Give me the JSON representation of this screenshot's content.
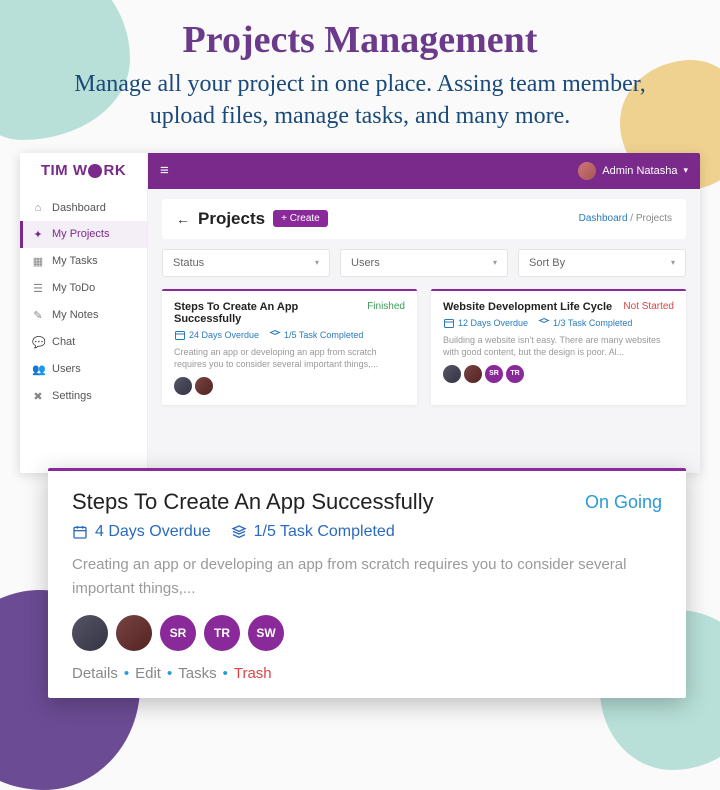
{
  "hero": {
    "title": "Projects Management",
    "subtitle": "Manage all your project in one place. Assing team member, upload files, manage tasks, and many more."
  },
  "logo": {
    "pre": "TIM W",
    "post": "RK"
  },
  "navbar": {
    "user_label": "Admin Natasha"
  },
  "sidebar": {
    "items": [
      {
        "icon": "home-icon",
        "glyph": "⌂",
        "label": "Dashboard"
      },
      {
        "icon": "projects-icon",
        "glyph": "✦",
        "label": "My Projects",
        "active": true
      },
      {
        "icon": "tasks-icon",
        "glyph": "▦",
        "label": "My Tasks"
      },
      {
        "icon": "todo-icon",
        "glyph": "☰",
        "label": "My ToDo"
      },
      {
        "icon": "notes-icon",
        "glyph": "✎",
        "label": "My Notes"
      },
      {
        "icon": "chat-icon",
        "glyph": "💬",
        "label": "Chat"
      },
      {
        "icon": "users-icon",
        "glyph": "👥",
        "label": "Users"
      },
      {
        "icon": "settings-icon",
        "glyph": "✖",
        "label": "Settings"
      }
    ]
  },
  "page": {
    "title": "Projects",
    "create_label": "+ Create",
    "crumb_root": "Dashboard",
    "crumb_sep": " / ",
    "crumb_current": "Projects"
  },
  "filters": {
    "status": "Status",
    "users": "Users",
    "sort": "Sort By"
  },
  "cards": [
    {
      "title": "Steps To Create An App Successfully",
      "status": "Finished",
      "status_class": "st-fin",
      "overdue": "24 Days Overdue",
      "completed": "1/5 Task Completed",
      "desc": "Creating an app or developing an app from scratch requires you to consider several important things,...",
      "avatars": [
        {
          "cls": "img1"
        },
        {
          "cls": "img2"
        }
      ]
    },
    {
      "title": "Website Development Life Cycle",
      "status": "Not Started",
      "status_class": "st-not",
      "overdue": "12 Days Overdue",
      "completed": "1/3 Task Completed",
      "desc": "Building a website isn't easy. There are many websites with good content, but the design is poor. Al...",
      "avatars": [
        {
          "cls": "img1"
        },
        {
          "cls": "img2"
        },
        {
          "txt": "SR"
        },
        {
          "txt": "TR"
        }
      ]
    }
  ],
  "overlay": {
    "title": "Steps To Create An App Successfully",
    "status": "On Going",
    "overdue": "4 Days Overdue",
    "completed": "1/5 Task Completed",
    "desc": "Creating an app or developing an app from scratch requires you to consider several important things,...",
    "avatars": [
      {
        "cls": "img1"
      },
      {
        "cls": "img2"
      },
      {
        "txt": "SR"
      },
      {
        "txt": "TR"
      },
      {
        "txt": "SW"
      }
    ],
    "actions": {
      "details": "Details",
      "edit": "Edit",
      "tasks": "Tasks",
      "trash": "Trash"
    }
  }
}
